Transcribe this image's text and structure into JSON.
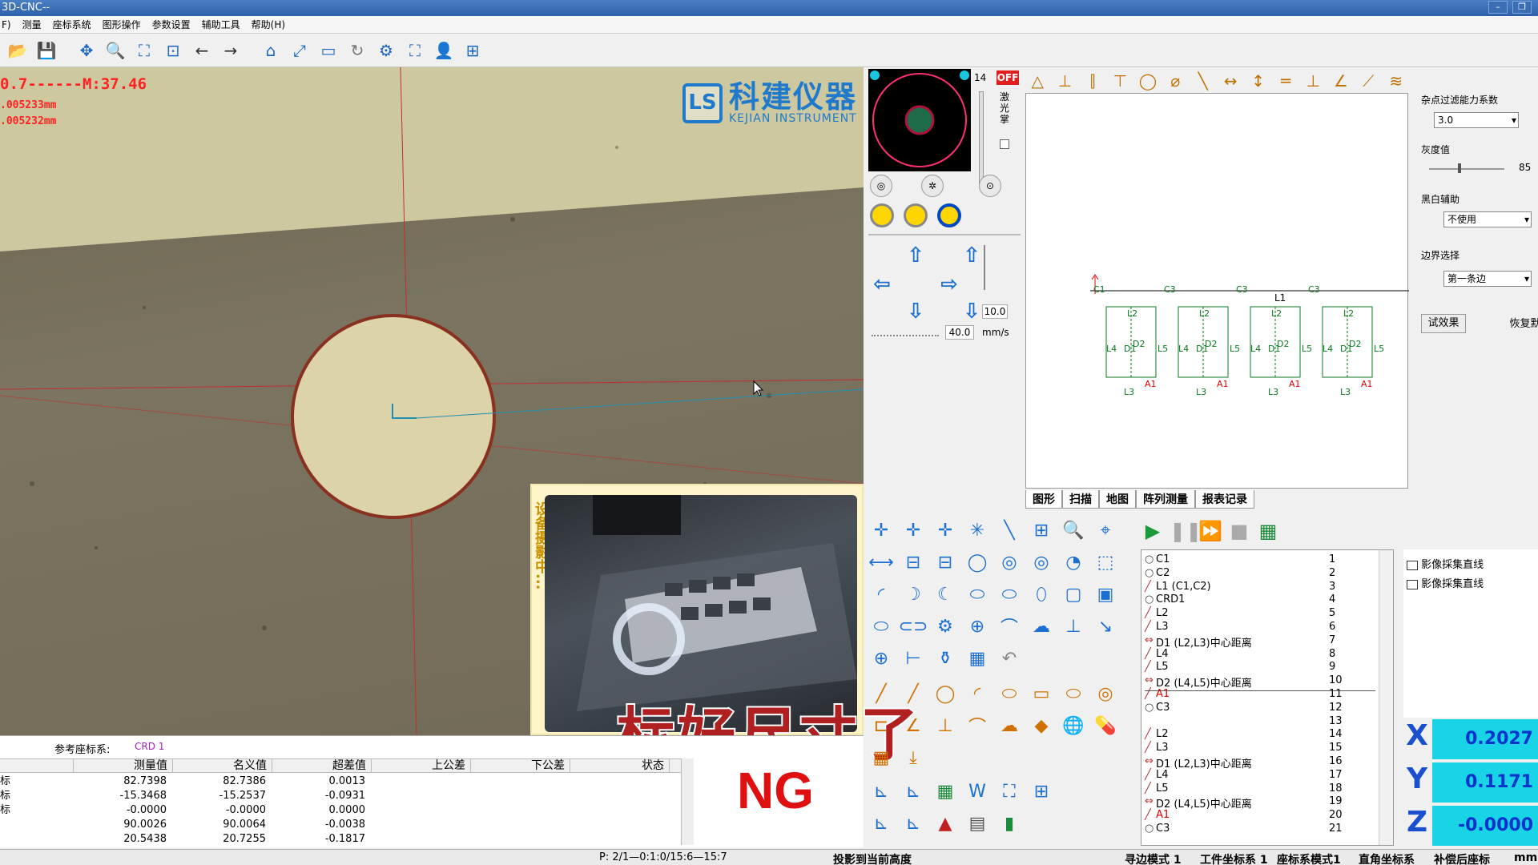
{
  "window": {
    "title": "3D-CNC--"
  },
  "menu": [
    "F)",
    "测量",
    "座标系统",
    "图形操作",
    "参数设置",
    "辅助工具",
    "帮助(H)"
  ],
  "camera": {
    "readout_line1": "0.7------M:37.46",
    "readout_line2": ".005233mm",
    "readout_line3": ".005232mm",
    "logo_cn": "科建仪器",
    "logo_en": "KEJIAN INSTRUMENT",
    "logo_mark": "LS"
  },
  "inset": {
    "label": "设备摄影中..."
  },
  "subtitle": "标好尺寸了",
  "verdict": "NG",
  "results": {
    "ref_label": "参考座标系:",
    "ref_value": "CRD 1",
    "columns": [
      "测量值",
      "名义值",
      "超差值",
      "上公差",
      "下公差",
      "状态"
    ],
    "rows": [
      {
        "name": "标",
        "measured": "82.7398",
        "nominal": "82.7386",
        "deviation": "0.0013"
      },
      {
        "name": "标",
        "measured": "-15.3468",
        "nominal": "-15.2537",
        "deviation": "-0.0931"
      },
      {
        "name": "标",
        "measured": "-0.0000",
        "nominal": "-0.0000",
        "deviation": "0.0000"
      },
      {
        "name": "",
        "measured": "90.0026",
        "nominal": "90.0064",
        "deviation": "-0.0038"
      },
      {
        "name": "",
        "measured": "20.5438",
        "nominal": "20.7255",
        "deviation": "-0.1817"
      }
    ]
  },
  "controls": {
    "light_value": "14",
    "light_state": "OFF",
    "laser_label": "激光掌",
    "speed_z": "10.0",
    "speed_xy": "40.0",
    "speed_unit": "mm/s"
  },
  "canvas": {
    "tabs": [
      "图形",
      "扫描",
      "地图",
      "阵列测量",
      "报表记录"
    ],
    "labels": {
      "c1": "C1",
      "c3": "C3",
      "l1": "L1",
      "l2": "L2",
      "l3": "L3",
      "l4": "L4",
      "l5": "L5",
      "d1": "D1",
      "d2": "D2",
      "a1": "A1"
    }
  },
  "settings": {
    "noise_label": "杂点过滤能力系数",
    "noise_value": "3.0",
    "gray_label": "灰度值",
    "gray_value": "85",
    "bw_label": "黑白辅助",
    "bw_value": "不使用",
    "edge_label": "边界选择",
    "edge_value": "第一条边",
    "try_btn": "试效果",
    "restore_btn": "恢复默"
  },
  "features": [
    {
      "name": "C1",
      "num": "1"
    },
    {
      "name": "C2",
      "num": "2"
    },
    {
      "name": "L1 (C1,C2)",
      "num": "3"
    },
    {
      "name": "CRD1",
      "num": "4"
    },
    {
      "name": "L2",
      "num": "5"
    },
    {
      "name": "L3",
      "num": "6"
    },
    {
      "name": "D1 (L2,L3)中心距离",
      "num": "7"
    },
    {
      "name": "L4",
      "num": "8"
    },
    {
      "name": "L5",
      "num": "9"
    },
    {
      "name": "D2 (L4,L5)中心距离",
      "num": "10"
    },
    {
      "name": "A1",
      "num": "11"
    },
    {
      "name": "C3",
      "num": "12"
    },
    {
      "name": "",
      "num": "13"
    },
    {
      "name": "L2",
      "num": "14"
    },
    {
      "name": "L3",
      "num": "15"
    },
    {
      "name": "D1 (L2,L3)中心距离",
      "num": "16"
    },
    {
      "name": "L4",
      "num": "17"
    },
    {
      "name": "L5",
      "num": "18"
    },
    {
      "name": "D2 (L4,L5)中心距离",
      "num": "19"
    },
    {
      "name": "A1",
      "num": "20"
    },
    {
      "name": "C3",
      "num": "21"
    }
  ],
  "collect": [
    "影像採集直线",
    "影像採集直线"
  ],
  "xyz": {
    "x_label": "X",
    "x": "0.2027",
    "y_label": "Y",
    "y": "0.1171",
    "z_label": "Z",
    "z": "-0.0000"
  },
  "status": {
    "coords": "P: 2/1—0:1:0/15:6—15:7",
    "projection": "投影到当前高度",
    "edge_mode": "寻边模式 1",
    "work_coord": "工件坐标系 1",
    "coord_mode": "座标系模式1",
    "rect_coord": "直角坐标系",
    "comp_coord": "补偿后座标",
    "unit": "mm"
  },
  "colors": {
    "accent": "#1b6fd2",
    "ng_red": "#e01010",
    "xyz_bg": "#19d3e6"
  }
}
